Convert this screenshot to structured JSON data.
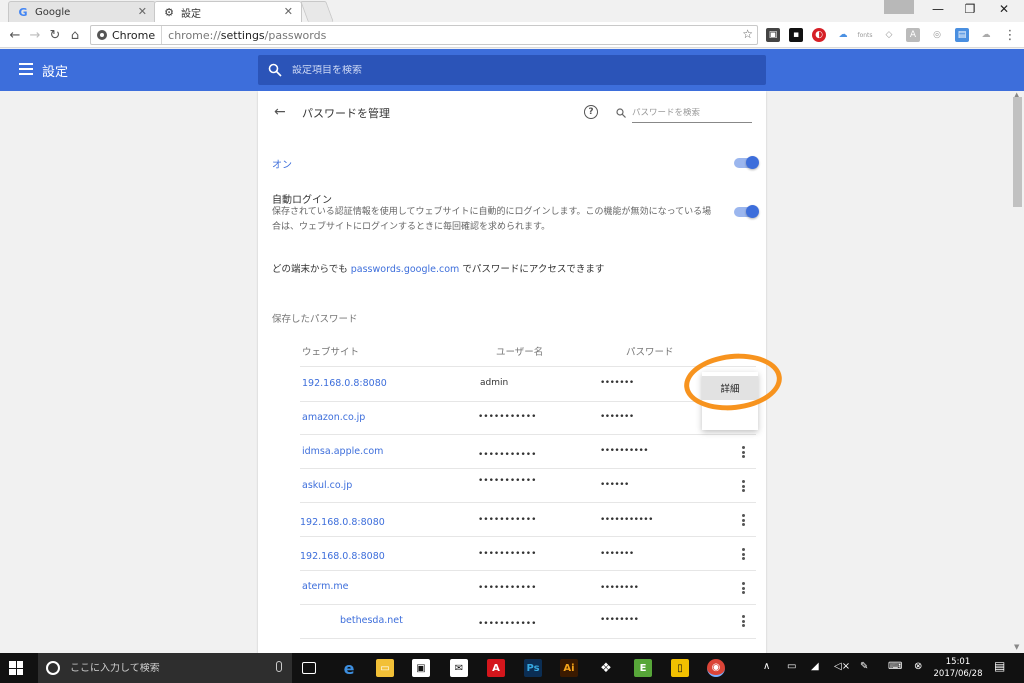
{
  "browser": {
    "tabs": [
      {
        "title": "Google",
        "icon": "google-g-icon",
        "active": false
      },
      {
        "title": "設定",
        "icon": "gear-icon",
        "active": true
      }
    ],
    "omnibox": {
      "chip": "Chrome",
      "url_prefix": "chrome://",
      "url_bold": "settings",
      "url_suffix": "/passwords"
    }
  },
  "header": {
    "title": "設定",
    "search_placeholder": "設定項目を検索"
  },
  "page": {
    "title": "パスワードを管理",
    "search_placeholder": "パスワードを検索",
    "on_label": "オン",
    "autologin_title": "自動ログイン",
    "autologin_desc": "保存されている認証情報を使用してウェブサイトに自動的にログインします。この機能が無効になっている場合は、ウェブサイトにログインするときに毎回確認を求められます。",
    "access_prefix": "どの端末からでも ",
    "access_link": "passwords.google.com",
    "access_suffix": " でパスワードにアクセスできます",
    "saved_label": "保存したパスワード",
    "columns": {
      "site": "ウェブサイト",
      "user": "ユーザー名",
      "password": "パスワード"
    },
    "rows": [
      {
        "site": "192.168.0.8:8080",
        "user": "admin",
        "password": "•••••••"
      },
      {
        "site": "amazon.co.jp",
        "user": "•••••••••••",
        "password": "•••••••"
      },
      {
        "site": "idmsa.apple.com",
        "user": "•••••••••••",
        "password": "••••••••••"
      },
      {
        "site": "askul.co.jp",
        "user": "•••••••••••",
        "password": "••••••"
      },
      {
        "site": "192.168.0.8:8080",
        "user": "•••••••••••",
        "password": "•••••••••••"
      },
      {
        "site": "192.168.0.8:8080",
        "user": "•••••••••••",
        "password": "•••••••"
      },
      {
        "site": "aterm.me",
        "user": "•••••••••••",
        "password": "••••••••"
      },
      {
        "site": "bethesda.net",
        "user": "•••••••••••",
        "password": "••••••••"
      }
    ],
    "popup_detail": "詳細"
  },
  "taskbar": {
    "search_placeholder": "ここに入力して検索",
    "time": "15:01",
    "date": "2017/06/28"
  },
  "colors": {
    "accent": "#3d6edb",
    "annotation": "#f7931e"
  }
}
